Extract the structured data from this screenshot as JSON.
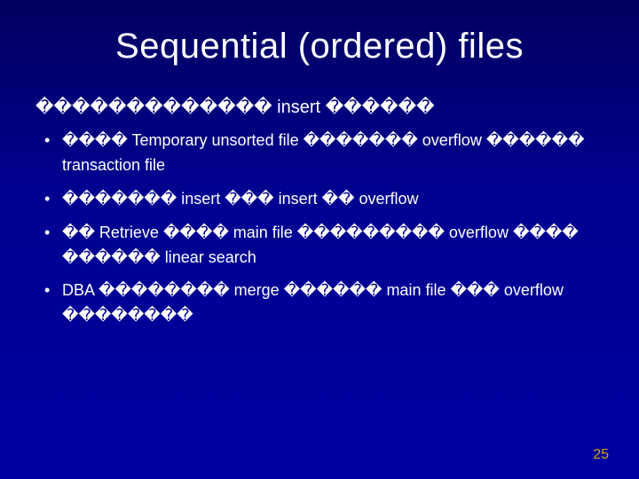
{
  "title": "Sequential (ordered) files",
  "lead": "������������� insert ������",
  "bullets": [
    {
      "line1": "���� Temporary unsorted file ������� overflow ������",
      "line2": "transaction file"
    },
    {
      "line1": "������� insert ��� insert �� overflow"
    },
    {
      "line1": "�� Retrieve ���� main file ��������� overflow ����",
      "line2": "������ linear search"
    },
    {
      "line1": "DBA �������� merge ������ main file ��� overflow",
      "line2": "��������"
    }
  ],
  "page_number": "25"
}
